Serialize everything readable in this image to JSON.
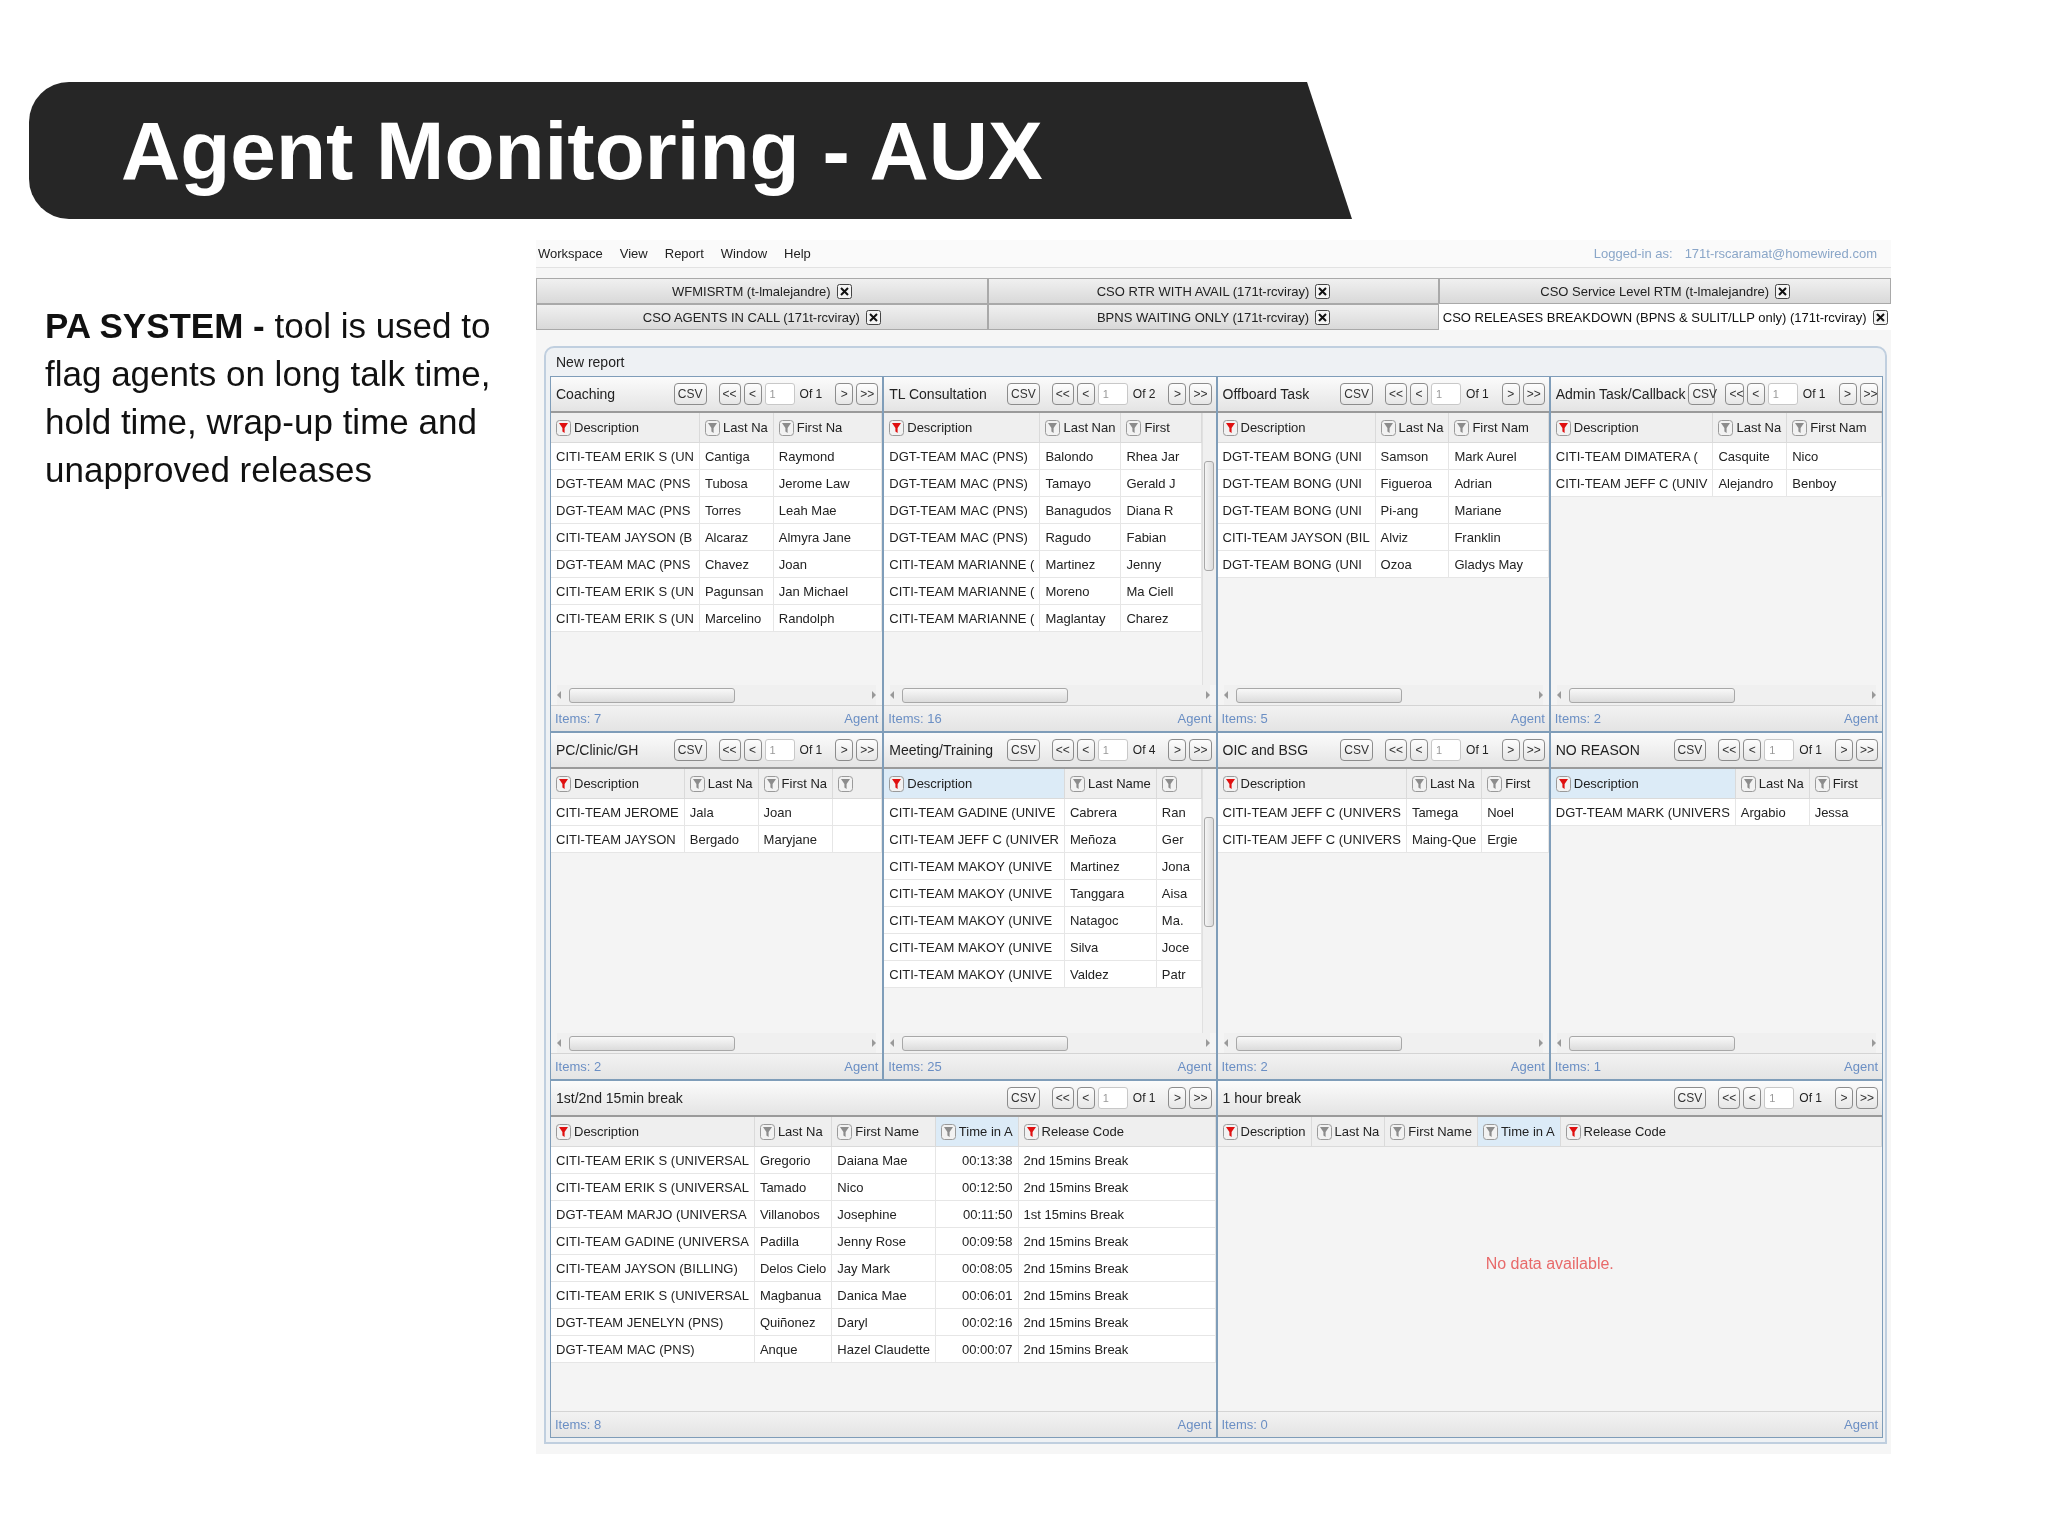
{
  "slide": {
    "title": "Agent Monitoring - AUX",
    "description": "**PA SYSTEM -** tool is used to flag agents on long talk time, hold time, wrap-up time and unapproved releases"
  },
  "app": {
    "menu": [
      "Workspace",
      "View",
      "Report",
      "Window",
      "Help"
    ],
    "login_label": "Logged-in as:",
    "login_user": "171t-rscaramat@homewired.com",
    "tab_rows": [
      [
        {
          "label": "WFMISRTM (t-lmalejandre)",
          "selected": false
        },
        {
          "label": "CSO RTR WITH AVAIL (171t-rcviray)",
          "selected": false
        },
        {
          "label": "CSO Service Level RTM (t-lmalejandre)",
          "selected": false
        }
      ],
      [
        {
          "label": "CSO AGENTS IN CALL (171t-rcviray)",
          "selected": false
        },
        {
          "label": "BPNS WAITING ONLY (171t-rcviray)",
          "selected": false
        },
        {
          "label": "CSO RELEASES BREAKDOWN (BPNS & SULIT/LLP only) (171t-rcviray)",
          "selected": true
        }
      ]
    ],
    "report_title": "New report",
    "panels": [
      {
        "kind": "narrow",
        "title": "Coaching",
        "csv": "CSV",
        "pager": {
          "first": "<<",
          "prev": "<",
          "page": "1",
          "of": "Of 1",
          "next": ">",
          "last": ">>"
        },
        "scrollable": false,
        "columns": [
          {
            "label": "Description",
            "filter_active": true,
            "highlighted": false
          },
          {
            "label": "Last Na",
            "filter_active": false,
            "highlighted": false
          },
          {
            "label": "First Na",
            "filter_active": false,
            "highlighted": false
          }
        ],
        "rows": [
          [
            "CITI-TEAM ERIK S (UN",
            "Cantiga",
            "Raymond"
          ],
          [
            "DGT-TEAM MAC (PNS",
            "Tubosa",
            "Jerome Law"
          ],
          [
            "DGT-TEAM MAC (PNS",
            "Torres",
            "Leah Mae"
          ],
          [
            "CITI-TEAM JAYSON (B",
            "Alcaraz",
            "Almyra Jane"
          ],
          [
            "DGT-TEAM MAC (PNS",
            "Chavez",
            "Joan"
          ],
          [
            "CITI-TEAM ERIK S (UN",
            "Pagunsan",
            "Jan Michael"
          ],
          [
            "CITI-TEAM ERIK S (UN",
            "Marcelino",
            "Randolph"
          ]
        ],
        "items": "Items: 7",
        "footer_right": "Agent"
      },
      {
        "kind": "narrow",
        "title": "TL Consultation",
        "csv": "CSV",
        "pager": {
          "first": "<<",
          "prev": "<",
          "page": "1",
          "of": "Of 2",
          "next": ">",
          "last": ">>"
        },
        "scrollable": true,
        "columns": [
          {
            "label": "Description",
            "filter_active": true,
            "highlighted": false
          },
          {
            "label": "Last Nan",
            "filter_active": false,
            "highlighted": false
          },
          {
            "label": "First",
            "filter_active": false,
            "highlighted": false
          }
        ],
        "rows": [
          [
            "DGT-TEAM MAC (PNS)",
            "Balondo",
            "Rhea Jar"
          ],
          [
            "DGT-TEAM MAC (PNS)",
            "Tamayo",
            "Gerald J"
          ],
          [
            "DGT-TEAM MAC (PNS)",
            "Banagudos",
            "Diana R"
          ],
          [
            "DGT-TEAM MAC (PNS)",
            "Ragudo",
            "Fabian"
          ],
          [
            "CITI-TEAM MARIANNE (",
            "Martinez",
            "Jenny"
          ],
          [
            "CITI-TEAM MARIANNE (",
            "Moreno",
            "Ma Ciell"
          ],
          [
            "CITI-TEAM MARIANNE (",
            "Maglantay",
            "Charez"
          ]
        ],
        "items": "Items: 16",
        "footer_right": "Agent"
      },
      {
        "kind": "narrow",
        "title": "Offboard Task",
        "csv": "CSV",
        "pager": {
          "first": "<<",
          "prev": "<",
          "page": "1",
          "of": "Of 1",
          "next": ">",
          "last": ">>"
        },
        "scrollable": false,
        "columns": [
          {
            "label": "Description",
            "filter_active": true,
            "highlighted": false
          },
          {
            "label": "Last Na",
            "filter_active": false,
            "highlighted": false
          },
          {
            "label": "First Nam",
            "filter_active": false,
            "highlighted": false
          }
        ],
        "rows": [
          [
            "DGT-TEAM BONG (UNI",
            "Samson",
            "Mark Aurel"
          ],
          [
            "DGT-TEAM BONG (UNI",
            "Figueroa",
            "Adrian"
          ],
          [
            "DGT-TEAM BONG (UNI",
            "Pi-ang",
            "Mariane"
          ],
          [
            "CITI-TEAM JAYSON (BIL",
            "Alviz",
            "Franklin"
          ],
          [
            "DGT-TEAM BONG (UNI",
            "Ozoa",
            "Gladys May"
          ]
        ],
        "items": "Items: 5",
        "footer_right": "Agent"
      },
      {
        "kind": "narrow",
        "title": "Admin Task/Callback",
        "csv": "CSV",
        "pager": {
          "first": "<<",
          "prev": "<",
          "page": "1",
          "of": "Of 1",
          "next": ">",
          "last": ">>"
        },
        "scrollable": false,
        "columns": [
          {
            "label": "Description",
            "filter_active": true,
            "highlighted": false
          },
          {
            "label": "Last Na",
            "filter_active": false,
            "highlighted": false
          },
          {
            "label": "First Nam",
            "filter_active": false,
            "highlighted": false
          }
        ],
        "rows": [
          [
            "CITI-TEAM DIMATERA (",
            "Casquite",
            "Nico"
          ],
          [
            "CITI-TEAM JEFF C (UNIV",
            "Alejandro",
            "Benboy"
          ]
        ],
        "items": "Items: 2",
        "footer_right": "Agent"
      },
      {
        "kind": "narrow",
        "title": "PC/Clinic/GH",
        "csv": "CSV",
        "pager": {
          "first": "<<",
          "prev": "<",
          "page": "1",
          "of": "Of 1",
          "next": ">",
          "last": ">>"
        },
        "scrollable": false,
        "columns": [
          {
            "label": "Description",
            "filter_active": true,
            "highlighted": false
          },
          {
            "label": "Last Na",
            "filter_active": false,
            "highlighted": false
          },
          {
            "label": "First Na",
            "filter_active": false,
            "highlighted": false
          },
          {
            "filter_active": false,
            "highlighted": false
          }
        ],
        "rows": [
          [
            "CITI-TEAM JEROME",
            "Jala",
            "Joan"
          ],
          [
            "CITI-TEAM JAYSON",
            "Bergado",
            "Maryjane"
          ]
        ],
        "items": "Items: 2",
        "footer_right": "Agent"
      },
      {
        "kind": "narrow",
        "title": "Meeting/Training",
        "csv": "CSV",
        "pager": {
          "first": "<<",
          "prev": "<",
          "page": "1",
          "of": "Of 4",
          "next": ">",
          "last": ">>"
        },
        "scrollable": true,
        "columns": [
          {
            "label": "Description",
            "filter_active": true,
            "highlighted": true
          },
          {
            "label": "Last Name",
            "filter_active": false,
            "highlighted": false
          },
          {
            "filter_active": false,
            "highlighted": false
          }
        ],
        "rows": [
          [
            "CITI-TEAM GADINE (UNIVE",
            "Cabrera",
            "Ran"
          ],
          [
            "CITI-TEAM JEFF C (UNIVER",
            "Meñoza",
            "Ger"
          ],
          [
            "CITI-TEAM MAKOY (UNIVE",
            "Martinez",
            "Jona"
          ],
          [
            "CITI-TEAM MAKOY (UNIVE",
            "Tanggara",
            "Aisa"
          ],
          [
            "CITI-TEAM MAKOY (UNIVE",
            "Natagoc",
            "Ma."
          ],
          [
            "CITI-TEAM MAKOY (UNIVE",
            "Silva",
            "Joce"
          ],
          [
            "CITI-TEAM MAKOY (UNIVE",
            "Valdez",
            "Patr"
          ]
        ],
        "items": "Items: 25",
        "footer_right": "Agent"
      },
      {
        "kind": "narrow",
        "title": "OIC and BSG",
        "csv": "CSV",
        "pager": {
          "first": "<<",
          "prev": "<",
          "page": "1",
          "of": "Of 1",
          "next": ">",
          "last": ">>"
        },
        "scrollable": false,
        "columns": [
          {
            "label": "Description",
            "filter_active": true,
            "highlighted": false
          },
          {
            "label": "Last Na",
            "filter_active": false,
            "highlighted": false
          },
          {
            "label": "First",
            "filter_active": false,
            "highlighted": false
          }
        ],
        "rows": [
          [
            "CITI-TEAM JEFF C (UNIVERS",
            "Tamega",
            "Noel"
          ],
          [
            "CITI-TEAM JEFF C (UNIVERS",
            "Maing-Que",
            "Ergie"
          ]
        ],
        "items": "Items: 2",
        "footer_right": "Agent"
      },
      {
        "kind": "narrow",
        "title": "NO REASON",
        "csv": "CSV",
        "pager": {
          "first": "<<",
          "prev": "<",
          "page": "1",
          "of": "Of 1",
          "next": ">",
          "last": ">>"
        },
        "scrollable": false,
        "columns": [
          {
            "label": "Description",
            "filter_active": true,
            "highlighted": true
          },
          {
            "label": "Last Na",
            "filter_active": false,
            "highlighted": false
          },
          {
            "label": "First",
            "filter_active": false,
            "highlighted": false
          }
        ],
        "rows": [
          [
            "DGT-TEAM MARK (UNIVERS",
            "Argabio",
            "Jessa"
          ]
        ],
        "items": "Items: 1",
        "footer_right": "Agent"
      },
      {
        "kind": "wide",
        "title": "1st/2nd 15min break",
        "csv": "CSV",
        "pager": {
          "first": "<<",
          "prev": "<",
          "page": "1",
          "of": "Of 1",
          "next": ">",
          "last": ">>"
        },
        "scrollable": false,
        "columns": [
          {
            "label": "Description",
            "filter_active": true,
            "highlighted": false
          },
          {
            "label": "Last Na",
            "filter_active": false,
            "highlighted": false
          },
          {
            "label": "First Name",
            "filter_active": false,
            "highlighted": false
          },
          {
            "label": "Time in A",
            "filter_active": false,
            "highlighted": true,
            "right_aligned": true
          },
          {
            "label": "Release Code",
            "filter_active": true,
            "highlighted": false
          }
        ],
        "rows": [
          [
            "CITI-TEAM ERIK S (UNIVERSAL",
            "Gregorio",
            "Daiana Mae",
            "00:13:38",
            "2nd 15mins Break"
          ],
          [
            "CITI-TEAM ERIK S (UNIVERSAL",
            "Tamado",
            "Nico",
            "00:12:50",
            "2nd 15mins Break"
          ],
          [
            "DGT-TEAM MARJO (UNIVERSA",
            "Villanobos",
            "Josephine",
            "00:11:50",
            "1st 15mins Break"
          ],
          [
            "CITI-TEAM GADINE (UNIVERSA",
            "Padilla",
            "Jenny Rose",
            "00:09:58",
            "2nd 15mins Break"
          ],
          [
            "CITI-TEAM JAYSON (BILLING)",
            "Delos Cielo",
            "Jay Mark",
            "00:08:05",
            "2nd 15mins Break"
          ],
          [
            "CITI-TEAM ERIK S (UNIVERSAL",
            "Magbanua",
            "Danica Mae",
            "00:06:01",
            "2nd 15mins Break"
          ],
          [
            "DGT-TEAM JENELYN (PNS)",
            "Quiñonez",
            "Daryl",
            "00:02:16",
            "2nd 15mins Break"
          ],
          [
            "DGT-TEAM MAC (PNS)",
            "Anque",
            "Hazel Claudette",
            "00:00:07",
            "2nd 15mins Break"
          ]
        ],
        "items": "Items: 8",
        "footer_right": "Agent"
      },
      {
        "kind": "wide",
        "title": "1 hour break",
        "csv": "CSV",
        "pager": {
          "first": "<<",
          "prev": "<",
          "page": "1",
          "of": "Of 1",
          "next": ">",
          "last": ">>"
        },
        "scrollable": false,
        "columns": [
          {
            "label": "Description",
            "filter_active": true,
            "highlighted": false
          },
          {
            "label": "Last Na",
            "filter_active": false,
            "highlighted": false
          },
          {
            "label": "First Name",
            "filter_active": false,
            "highlighted": false
          },
          {
            "label": "Time in A",
            "filter_active": false,
            "highlighted": true
          },
          {
            "label": "Release Code",
            "filter_active": true,
            "highlighted": false
          }
        ],
        "empty_message": "No data available.",
        "items": "Items: 0",
        "footer_right": "Agent"
      }
    ]
  }
}
